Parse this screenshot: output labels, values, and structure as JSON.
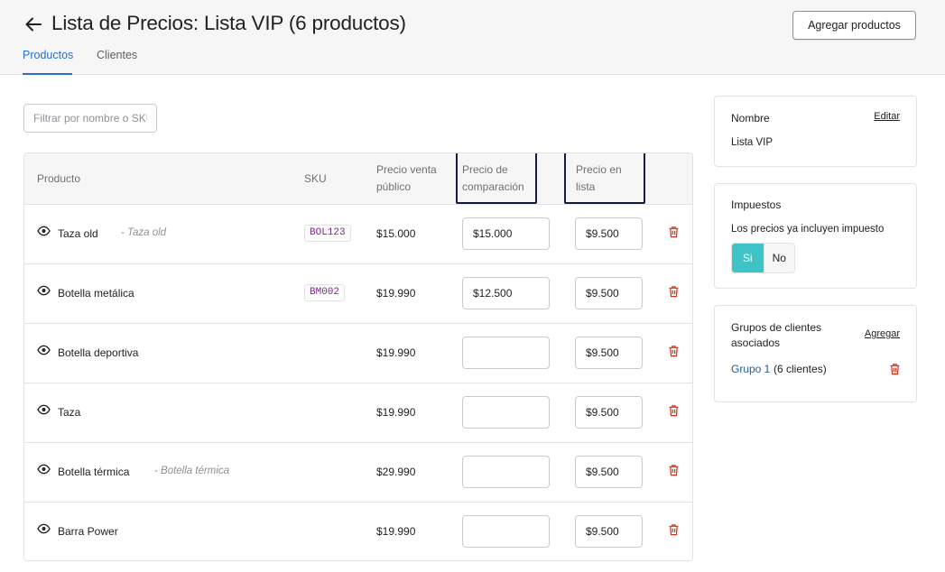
{
  "header": {
    "title": "Lista de Precios: Lista VIP (6 productos)",
    "add_products_label": "Agregar productos",
    "back_icon": "arrow-left-icon"
  },
  "tabs": [
    {
      "label": "Productos",
      "active": true
    },
    {
      "label": "Clientes",
      "active": false
    }
  ],
  "filter": {
    "placeholder": "Filtrar por nombre o SKU",
    "value": ""
  },
  "table": {
    "headers": {
      "product": "Producto",
      "sku": "SKU",
      "public_price": "Precio venta público",
      "compare_price": "Precio de comparación",
      "list_price": "Precio en lista"
    },
    "rows": [
      {
        "name": "Taza old",
        "variant": "- Taza old",
        "sku": "BOL123",
        "public_price": "$15.000",
        "compare_price": "$15.000",
        "list_price": "$9.500"
      },
      {
        "name": "Botella metálica",
        "variant": "",
        "sku": "BM002",
        "public_price": "$19.990",
        "compare_price": "$12.500",
        "list_price": "$9.500"
      },
      {
        "name": "Botella deportiva",
        "variant": "",
        "sku": "",
        "public_price": "$19.990",
        "compare_price": "",
        "list_price": "$9.500"
      },
      {
        "name": "Taza",
        "variant": "",
        "sku": "",
        "public_price": "$19.990",
        "compare_price": "",
        "list_price": "$9.500"
      },
      {
        "name": "Botella térmica",
        "variant": "- Botella térmica",
        "sku": "",
        "public_price": "$29.990",
        "compare_price": "",
        "list_price": "$9.500"
      },
      {
        "name": "Barra Power",
        "variant": "",
        "sku": "",
        "public_price": "$19.990",
        "compare_price": "",
        "list_price": "$9.500"
      }
    ]
  },
  "sidebar": {
    "name_card": {
      "title": "Nombre",
      "edit_label": "Editar",
      "value": "Lista VIP"
    },
    "tax_card": {
      "title": "Impuestos",
      "text": "Los precios ya incluyen impuesto",
      "yes_label": "Si",
      "no_label": "No",
      "selected": "Si"
    },
    "groups_card": {
      "title": "Grupos de clientes asociados",
      "add_label": "Agregar",
      "groups": [
        {
          "name": "Grupo 1",
          "count": "(6 clientes)"
        }
      ]
    }
  },
  "colors": {
    "accent": "#2c6ecb",
    "toggle_active": "#3ec4c6",
    "trash": "#d72c0d",
    "highlight_border": "#141a3a"
  }
}
